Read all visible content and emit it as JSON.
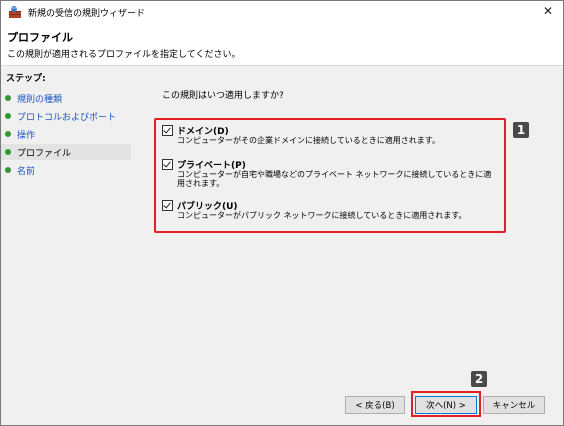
{
  "window": {
    "title": "新規の受信の規則ウィザード",
    "close_glyph": "✕"
  },
  "header": {
    "title": "プロファイル",
    "subtitle": "この規則が適用されるプロファイルを指定してください。"
  },
  "sidebar": {
    "steps_label": "ステップ:",
    "items": [
      {
        "label": "規則の種類",
        "active": false
      },
      {
        "label": "プロトコルおよびポート",
        "active": false
      },
      {
        "label": "操作",
        "active": false
      },
      {
        "label": "プロファイル",
        "active": true
      },
      {
        "label": "名前",
        "active": false
      }
    ]
  },
  "main": {
    "question": "この規則はいつ適用しますか?",
    "profiles": [
      {
        "label": "ドメイン(D)",
        "checked": true,
        "description": "コンピューターがその企業ドメインに接続しているときに適用されます。"
      },
      {
        "label": "プライベート(P)",
        "checked": true,
        "description": "コンピューターが自宅や職場などのプライベート ネットワークに接続しているときに適用されます。"
      },
      {
        "label": "パブリック(U)",
        "checked": true,
        "description": "コンピューターがパブリック ネットワークに接続しているときに適用されます。"
      }
    ]
  },
  "buttons": {
    "back": "< 戻る(B)",
    "next": "次へ(N) >",
    "cancel": "キャンセル"
  },
  "markers": {
    "first": "1",
    "second": "2"
  },
  "colors": {
    "highlight": "#e31e24",
    "link": "#1a56c4",
    "step_dot": "#2e9a2e",
    "marker_bg": "#4a4a4a"
  }
}
